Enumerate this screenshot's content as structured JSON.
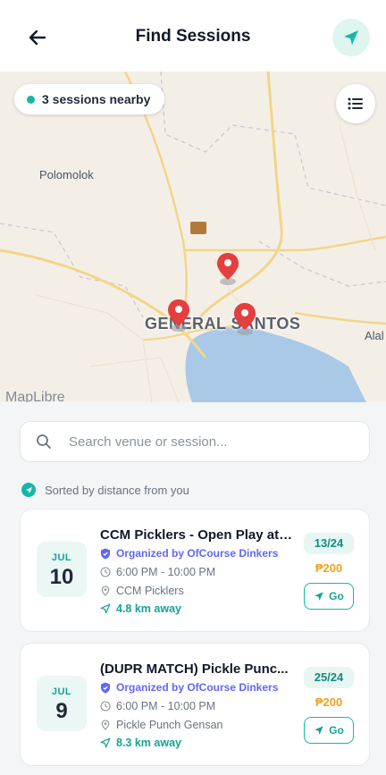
{
  "header": {
    "title": "Find Sessions",
    "back_icon": "arrow-left-icon",
    "locate_icon": "navigation-arrow-icon"
  },
  "map": {
    "nearby_label": "3 sessions nearby",
    "places": [
      "Polomolok",
      "GENERAL SANTOS",
      "Alal"
    ],
    "attribution": "MapLibre"
  },
  "search": {
    "placeholder": "Search venue or session..."
  },
  "sort_note": "Sorted by distance from you",
  "sessions": [
    {
      "month": "JUL",
      "day": "10",
      "title": "CCM Picklers - Open Play at ...",
      "organizer": "Organized by OfCourse Dinkers",
      "time": "6:00 PM - 10:00 PM",
      "venue": "CCM Picklers",
      "distance": "4.8 km away",
      "slots": "13/24",
      "price": "₱200",
      "go_label": "Go"
    },
    {
      "month": "JUL",
      "day": "9",
      "title": "(DUPR MATCH) Pickle Punc...",
      "organizer": "Organized by OfCourse Dinkers",
      "time": "6:00 PM - 10:00 PM",
      "venue": "Pickle Punch Gensan",
      "distance": "8.3 km away",
      "slots": "25/24",
      "price": "₱200",
      "go_label": "Go"
    }
  ],
  "colors": {
    "accent": "#14b8a6",
    "organizer": "#6366f1",
    "price": "#f0a020",
    "pin": "#e53e3e"
  }
}
